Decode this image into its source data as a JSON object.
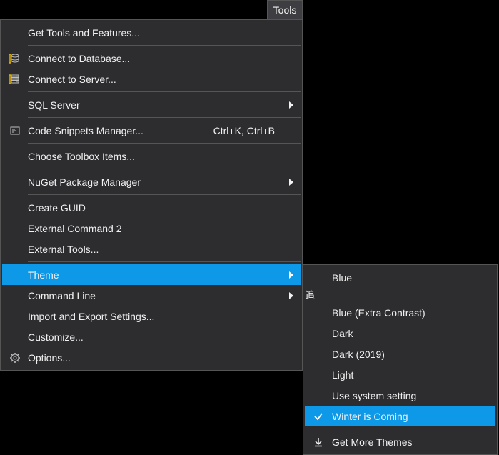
{
  "menubar": {
    "label": "Tools"
  },
  "menu": {
    "items": [
      {
        "label": "Get Tools and Features..."
      },
      {
        "label": "Connect to Database..."
      },
      {
        "label": "Connect to Server..."
      },
      {
        "label": "SQL Server"
      },
      {
        "label": "Code Snippets Manager...",
        "shortcut": "Ctrl+K, Ctrl+B"
      },
      {
        "label": "Choose Toolbox Items..."
      },
      {
        "label": "NuGet Package Manager"
      },
      {
        "label": "Create GUID"
      },
      {
        "label": "External Command 2"
      },
      {
        "label": "External Tools..."
      },
      {
        "label": "Theme"
      },
      {
        "label": "Command Line"
      },
      {
        "label": "Import and Export Settings..."
      },
      {
        "label": "Customize..."
      },
      {
        "label": "Options..."
      }
    ]
  },
  "submenu": {
    "items": [
      {
        "label": "Blue"
      },
      {
        "label": "Blue (Extra Contrast)"
      },
      {
        "label": "Dark"
      },
      {
        "label": "Dark (2019)"
      },
      {
        "label": "Light"
      },
      {
        "label": "Use system setting"
      },
      {
        "label": "Winter is Coming"
      },
      {
        "label": "Get More Themes"
      }
    ]
  },
  "colors": {
    "highlight": "#0e99e8",
    "menuBg": "#2d2d30",
    "border": "#555"
  }
}
